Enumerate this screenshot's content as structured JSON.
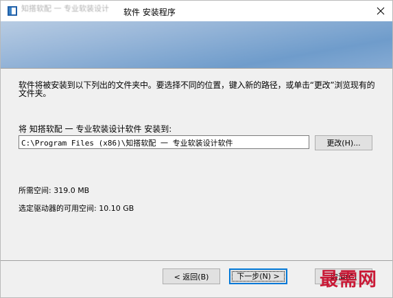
{
  "window": {
    "title": "软件 安装程序",
    "title_ghost": "知搭软配 一 专业软装设计",
    "close_glyph": "✕"
  },
  "content": {
    "description": "软件将被安装到以下列出的文件夹中。要选择不同的位置，键入新的路径，或单击“更改”浏览现有的文件夹。",
    "install_label": "将 知搭软配 一 专业软装设计软件 安装到:",
    "install_path": "C:\\Program Files (x86)\\知搭软配 一 专业软装设计软件",
    "change_button": "更改(H)...",
    "space_required": "所需空间: 319.0 MB",
    "space_available": "选定驱动器的可用空间: 10.10 GB"
  },
  "buttons": {
    "back": "< 返回(B)",
    "next": "下一步(N) >",
    "cancel": "取消(C)"
  },
  "watermark": "最需网",
  "colors": {
    "accent": "#0078d7",
    "banner": "#86abd4",
    "watermark": "#c8102e"
  },
  "icons": {
    "app": "installer-app-icon",
    "close": "close-icon"
  }
}
